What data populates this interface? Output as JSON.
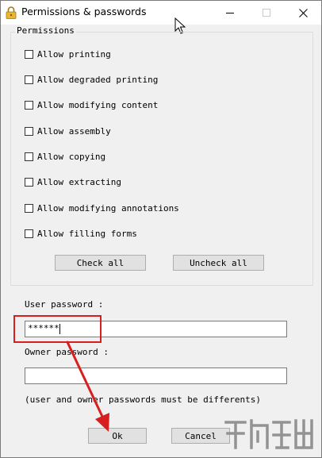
{
  "window": {
    "title": "Permissions & passwords"
  },
  "permissions": {
    "title": "Permissions",
    "items": [
      {
        "label": "Allow printing",
        "checked": false
      },
      {
        "label": "Allow degraded printing",
        "checked": false
      },
      {
        "label": "Allow modifying content",
        "checked": false
      },
      {
        "label": "Allow assembly",
        "checked": false
      },
      {
        "label": "Allow copying",
        "checked": false
      },
      {
        "label": "Allow extracting",
        "checked": false
      },
      {
        "label": "Allow modifying annotations",
        "checked": false
      },
      {
        "label": "Allow filling forms",
        "checked": false
      }
    ],
    "check_all": "Check all",
    "uncheck_all": "Uncheck all"
  },
  "user_password": {
    "label": "User password :",
    "value": "******"
  },
  "owner_password": {
    "label": "Owner password :",
    "value": ""
  },
  "note": "(user and owner passwords must be differents)",
  "buttons": {
    "ok": "Ok",
    "cancel": "Cancel"
  },
  "colors": {
    "annotation_red": "#d81e1e",
    "dialog_bg": "#f0f0f0"
  },
  "icons": {
    "title": "lock-icon",
    "minimize": "minimize-icon",
    "maximize": "maximize-icon",
    "close": "close-icon"
  }
}
